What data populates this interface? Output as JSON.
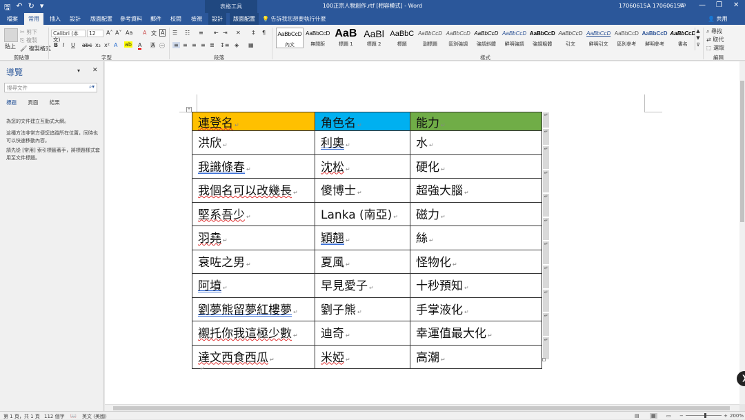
{
  "titlebar": {
    "title": "100正宗人物創作.rtf [相容模式] - Word",
    "user": "17060615A 17060615A",
    "contextual_group": "表格工具"
  },
  "tabs": [
    "檔案",
    "常用",
    "插入",
    "設計",
    "版面配置",
    "參考資料",
    "郵件",
    "校閱",
    "檢視",
    "設計",
    "版面配置"
  ],
  "tell_me": "告訴我您想要執行什麼",
  "share": "共用",
  "ribbon": {
    "clipboard": {
      "paste": "貼上",
      "cut": "剪下",
      "copy": "複製",
      "format_painter": "複製格式",
      "label": "剪貼簿"
    },
    "font": {
      "name": "Calibri (本文)",
      "size": "12",
      "label": "字型",
      "bold": "B",
      "italic": "I",
      "underline": "U",
      "strike": "abc"
    },
    "paragraph": {
      "label": "段落"
    },
    "styles": {
      "label": "樣式",
      "items": [
        {
          "sample": "AaBbCcD",
          "name": "內文"
        },
        {
          "sample": "AaBbCcD",
          "name": "無間距"
        },
        {
          "sample": "AaB",
          "name": "標題 1"
        },
        {
          "sample": "AaBl",
          "name": "標題 2"
        },
        {
          "sample": "AaBbC",
          "name": "標題"
        },
        {
          "sample": "AaBbCcD",
          "name": "副標題"
        },
        {
          "sample": "AaBbCcD",
          "name": "區別強調"
        },
        {
          "sample": "AaBbCcD",
          "name": "強調斜體"
        },
        {
          "sample": "AaBbCcD",
          "name": "鮮明強調"
        },
        {
          "sample": "AaBbCcD",
          "name": "強調粗體"
        },
        {
          "sample": "AaBbCcD",
          "name": "引文"
        },
        {
          "sample": "AaBbCcD",
          "name": "鮮明引文"
        },
        {
          "sample": "AaBbCcD",
          "name": "區別參考"
        },
        {
          "sample": "AaBbCcD",
          "name": "鮮明參考"
        },
        {
          "sample": "AaBbCcD",
          "name": "書名"
        }
      ]
    },
    "editing": {
      "find": "尋找",
      "replace": "取代",
      "select": "選取",
      "label": "編輯"
    }
  },
  "nav": {
    "title": "導覽",
    "search_placeholder": "搜尋文件",
    "tabs": [
      "標題",
      "頁面",
      "結果"
    ],
    "text1": "為您的文件建立互動式大綱。",
    "text2": "這種方法非常方便您追蹤所在位置，同時也可以快速移動內容。",
    "text3": "請先從 [常用] 索引標籤著手，將標題樣式套用至文件標題。"
  },
  "table": {
    "headers": [
      "連登名",
      "角色名",
      "能力"
    ],
    "rows": [
      [
        "洪欣",
        "利奧",
        "水"
      ],
      [
        "我識條春",
        "沈松",
        "硬化"
      ],
      [
        "我個名可以改幾長",
        "傻博士",
        "超強大腦"
      ],
      [
        "堅系吾少",
        "Lanka (南亞)",
        "磁力"
      ],
      [
        "羽堯",
        "穎翹",
        "絲"
      ],
      [
        "衰咗之男",
        "夏風",
        "怪物化"
      ],
      [
        "阿墳",
        "早見愛子",
        "十秒預知"
      ],
      [
        "劉夢熊留夢紅樓夢",
        "劉子熊",
        "手掌液化"
      ],
      [
        "襯托你我這極少數",
        "迪奇",
        "幸運值最大化"
      ],
      [
        "達文西食西瓜",
        "米婭",
        "高潮"
      ]
    ],
    "header_colors": [
      "#ffc000",
      "#00b0f0",
      "#70ad47"
    ]
  },
  "status": {
    "page": "第 1 頁，共 1 頁",
    "words": "112 個字",
    "language": "英文 (美國)",
    "zoom": "200%"
  },
  "colors": {
    "accent": "#2b579a"
  }
}
